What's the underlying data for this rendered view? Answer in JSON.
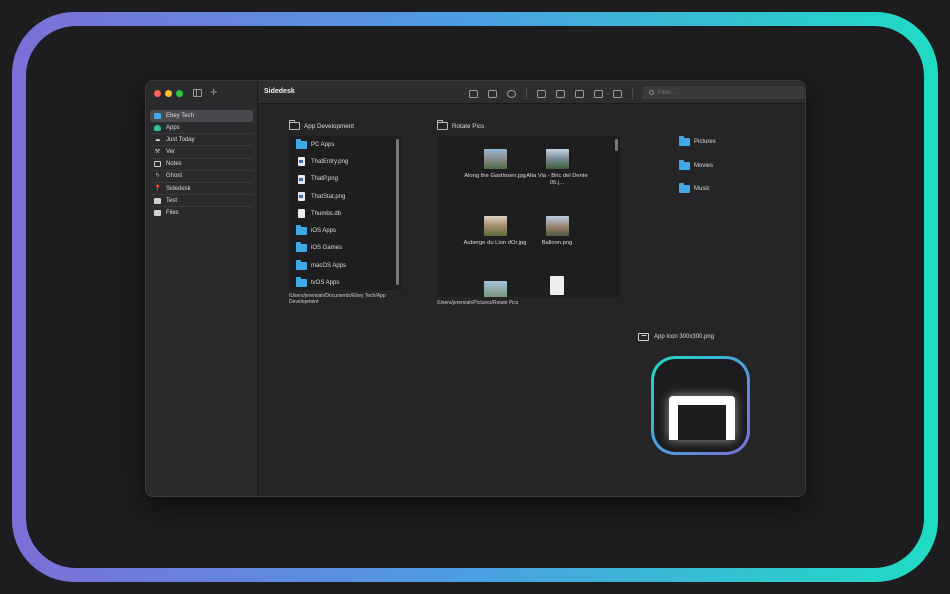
{
  "window": {
    "title": "Sidedesk"
  },
  "sidebar": {
    "items": [
      {
        "label": "Ebey Tech",
        "icon": "folder-icon",
        "color": "#3fa8e6",
        "active": true
      },
      {
        "label": "Apps",
        "icon": "cloud-icon",
        "color": "#2dc4a4"
      },
      {
        "label": "Just Today",
        "icon": "cloud-rain-icon",
        "color": "#cfcfcf"
      },
      {
        "label": "Ver",
        "icon": "hammer-icon",
        "color": "#cfcfcf"
      },
      {
        "label": "Notes",
        "icon": "tray-icon",
        "color": "#cfcfcf"
      },
      {
        "label": "Ghost",
        "icon": "bolt-icon",
        "color": "#cfcfcf"
      },
      {
        "label": "Sidedesk",
        "icon": "pin-icon",
        "color": "#fe5f57"
      },
      {
        "label": "Test",
        "icon": "stack-icon",
        "color": "#cfcfcf"
      },
      {
        "label": "Files",
        "icon": "folder-outline-icon",
        "color": "#cfcfcf"
      }
    ]
  },
  "toolbar": {
    "filter_placeholder": "Filter..."
  },
  "panels": {
    "app_dev": {
      "title": "App Development",
      "items": [
        {
          "label": "PC Apps",
          "kind": "folder"
        },
        {
          "label": "ThatEntry.png",
          "kind": "image"
        },
        {
          "label": "ThatP.png",
          "kind": "image"
        },
        {
          "label": "ThatStat.png",
          "kind": "image"
        },
        {
          "label": "Thumbs.db",
          "kind": "file"
        },
        {
          "label": "iOS Apps",
          "kind": "folder"
        },
        {
          "label": "iOS Games",
          "kind": "folder"
        },
        {
          "label": "macOS Apps",
          "kind": "folder"
        },
        {
          "label": "tvOS Apps",
          "kind": "folder"
        }
      ],
      "path": "/Users/jeremiah/Documents/Ebey Tech/App Development"
    },
    "rotate_pics": {
      "title": "Rotate Pics",
      "items": [
        {
          "label": "Along the Gastlosen.jpg"
        },
        {
          "label": "Alta Via - Bric del Dente 05.j..."
        },
        {
          "label": "Auberge du Lion dOr.jpg"
        },
        {
          "label": "Balloon.png"
        }
      ],
      "path": "/Users/jeremiah/Pictures/Rotate Pics"
    }
  },
  "free_items": {
    "folders": [
      "Pictures",
      "Movies",
      "Music"
    ],
    "image_file": "App Icon 300x300.png"
  }
}
